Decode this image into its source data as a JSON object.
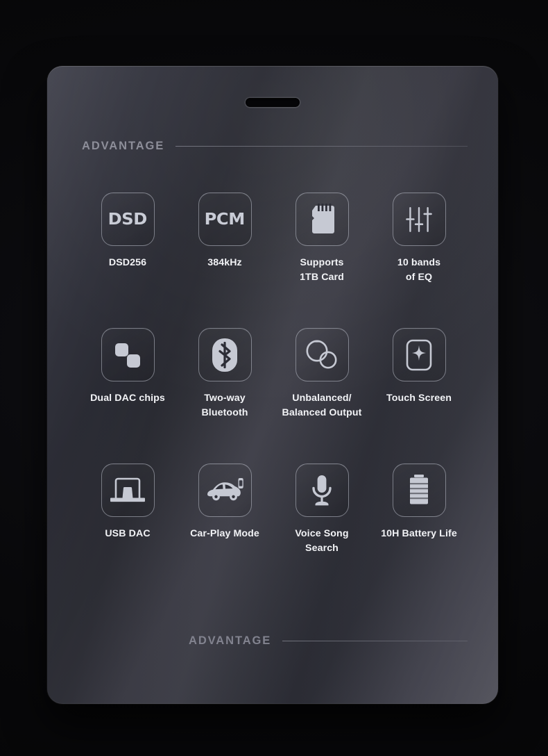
{
  "product_panel": {
    "speaker_slot": "speaker-grille",
    "section_heading_top": "ADVANTAGE",
    "section_heading_bottom": "ADVANTAGE",
    "accent_color": "#8d8e99",
    "label_color": "#f2f3f6",
    "icon_color": "#c6c9d3",
    "panel_color": "#33343e",
    "background_color": "#09090b"
  },
  "features": [
    {
      "id": "dsd",
      "icon": "dsd-wordmark-icon",
      "wordmark": "DSD",
      "label": "DSD256"
    },
    {
      "id": "pcm",
      "icon": "pcm-wordmark-icon",
      "wordmark": "PCM",
      "label": "384kHz"
    },
    {
      "id": "sd-card",
      "icon": "microsd-card-icon",
      "wordmark": "",
      "label": "Supports\n1TB Card"
    },
    {
      "id": "eq",
      "icon": "equalizer-sliders-icon",
      "wordmark": "",
      "label": "10 bands\nof EQ"
    },
    {
      "id": "dual-dac",
      "icon": "dual-chips-icon",
      "wordmark": "",
      "label": "Dual DAC chips"
    },
    {
      "id": "bluetooth",
      "icon": "bluetooth-icon",
      "wordmark": "",
      "label": "Two-way\nBluetooth"
    },
    {
      "id": "outputs",
      "icon": "dual-jack-sockets-icon",
      "wordmark": "",
      "label": "Unbalanced/\nBalanced Output"
    },
    {
      "id": "touch",
      "icon": "touch-screen-icon",
      "wordmark": "",
      "label": "Touch Screen"
    },
    {
      "id": "usb-dac",
      "icon": "usb-dac-laptop-icon",
      "wordmark": "",
      "label": "USB DAC"
    },
    {
      "id": "car-play",
      "icon": "car-icon",
      "wordmark": "",
      "label": "Car-Play Mode"
    },
    {
      "id": "voice",
      "icon": "microphone-icon",
      "wordmark": "",
      "label": "Voice Song\nSearch"
    },
    {
      "id": "battery",
      "icon": "battery-icon",
      "wordmark": "",
      "label": "10H Battery Life"
    }
  ]
}
